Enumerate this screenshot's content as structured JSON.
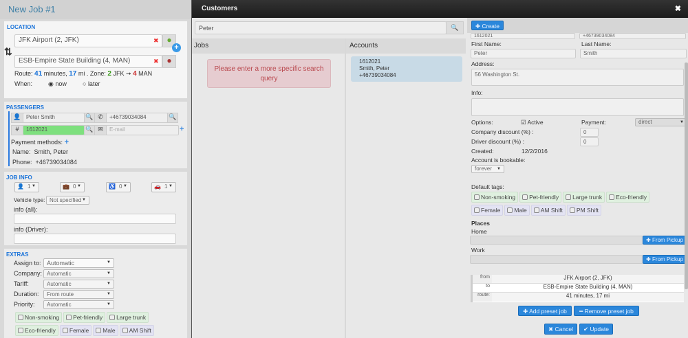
{
  "left": {
    "title": "New Job #1",
    "location": {
      "title": "LOCATION",
      "pickup": "JFK Airport (2, JFK)",
      "dropoff": "ESB-Empire State Building (4, MAN)",
      "route_label": "Route:",
      "minutes": "41",
      "minutes_unit": "minutes,",
      "miles": "17",
      "miles_unit": "mi . Zone:",
      "zone_from_num": "2",
      "zone_from": "JFK",
      "zone_to_num": "4",
      "zone_to": "MAN",
      "when_label": "When:",
      "now": "now",
      "later": "later"
    },
    "passengers": {
      "title": "PASSENGERS",
      "name": "Peter Smith",
      "phone": "+46739034084",
      "account": "1612021",
      "email_placeholder": "E-mail",
      "payment_methods": "Payment methods:",
      "name_label": "Name:",
      "name_value": "Smith, Peter",
      "phone_label": "Phone:",
      "phone_value": "+46739034084"
    },
    "job_info": {
      "title": "JOB INFO",
      "passengers": "1",
      "luggage": "0",
      "wheelchair": "0",
      "cars": "1",
      "vehicle_type_label": "Vehicle type:",
      "vehicle_type": "Not specified",
      "info_all": "info (all):",
      "info_driver": "info (Driver):"
    },
    "extras": {
      "title": "EXTRAS",
      "assign_label": "Assign to:",
      "assign": "Automatic",
      "company_label": "Company:",
      "company": "Automatic",
      "tariff_label": "Tariff:",
      "tariff": "Automatic",
      "duration_label": "Duration:",
      "duration": "From route",
      "priority_label": "Priority:",
      "priority": "Automatic",
      "tags": [
        "Non-smoking",
        "Pet-friendly",
        "Large trunk",
        "Eco-friendly",
        "Female",
        "Male",
        "AM Shift"
      ]
    }
  },
  "modal": {
    "title": "Customers",
    "search_value": "Peter",
    "jobs_header": "Jobs",
    "jobs_message": "Please enter a more specific search query",
    "accounts_header": "Accounts",
    "account": {
      "id": "1612021",
      "name": "Smith, Peter",
      "phone": "+46739034084"
    },
    "create": "Create",
    "form": {
      "account_no": "1612021",
      "phone": "+46739034084",
      "first_name_label": "First Name:",
      "first_name": "Peter",
      "last_name_label": "Last Name:",
      "last_name": "Smith",
      "address_label": "Address:",
      "address": "56 Washington St.",
      "info_label": "Info:",
      "options_label": "Options:",
      "active": "Active",
      "payment_label": "Payment:",
      "payment": "direct",
      "company_discount_label": "Company discount (%) :",
      "company_discount": "0",
      "driver_discount_label": "Driver discount (%) :",
      "driver_discount": "0",
      "created_label": "Created:",
      "created": "12/2/2016",
      "bookable_label": "Account is bookable:",
      "bookable": "forever",
      "default_tags_label": "Default tags:",
      "tags_green": [
        "Non-smoking",
        "Pet-friendly",
        "Large trunk",
        "Eco-friendly"
      ],
      "tags_purple": [
        "Female",
        "Male",
        "AM Shift",
        "PM Shift"
      ],
      "places_label": "Places",
      "home_label": "Home",
      "work_label": "Work",
      "from_pickup": "From Pickup",
      "preset": {
        "from_label": "from",
        "from": "JFK Airport (2, JFK)",
        "to_label": "to",
        "to": "ESB-Empire State Building (4, MAN)",
        "route_label": "route:",
        "route": "41 minutes, 17 mi"
      },
      "add_preset": "Add preset job",
      "remove_preset": "Remove preset job",
      "cancel": "Cancel",
      "update": "Update"
    }
  }
}
